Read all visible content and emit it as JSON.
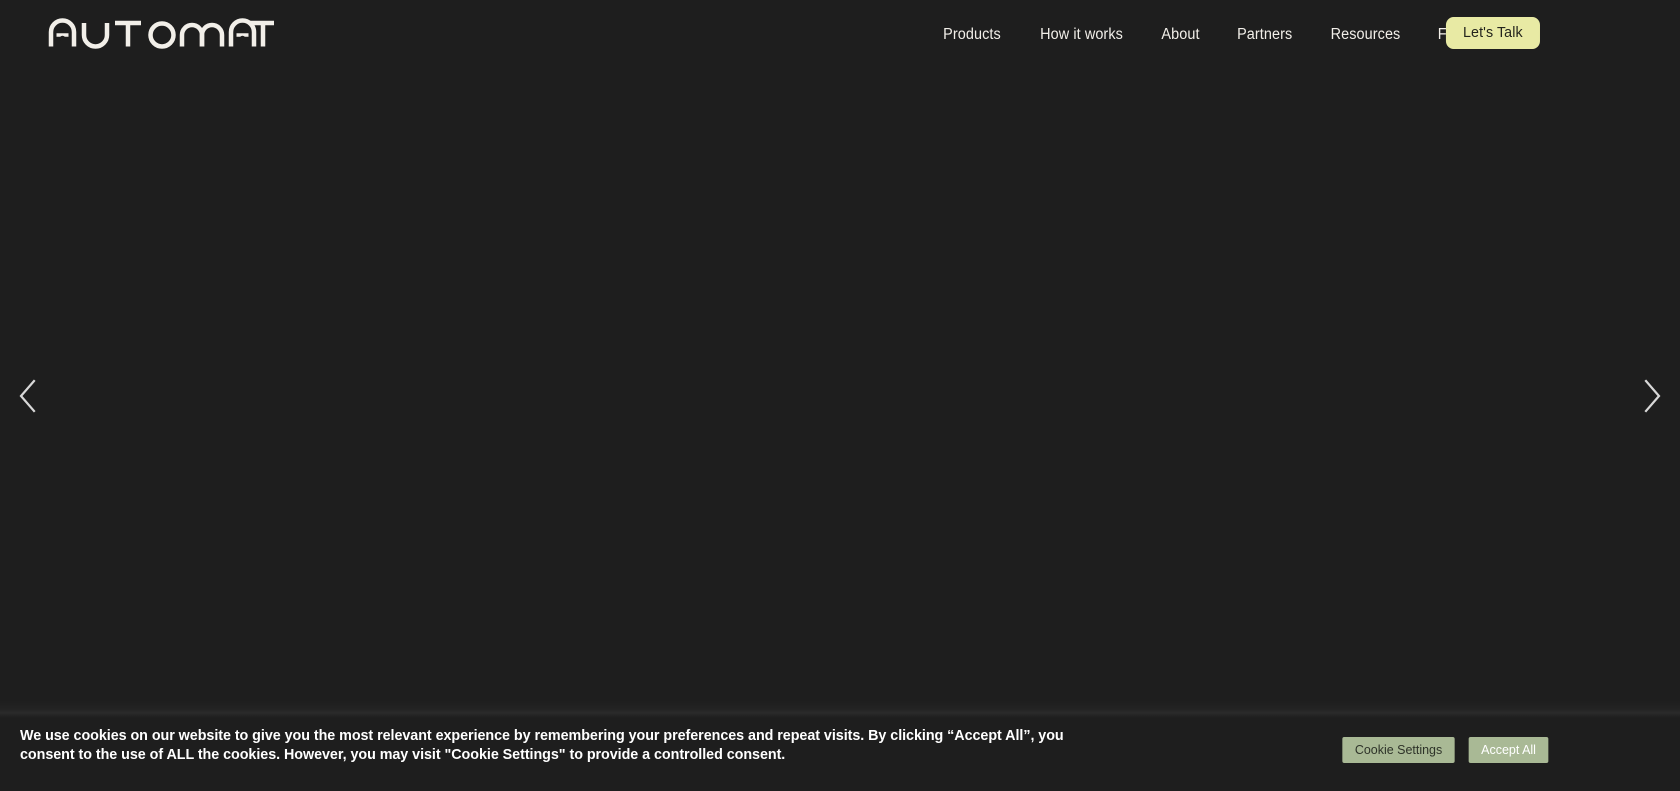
{
  "site": {
    "background_color": "#1e1e1e",
    "brand_name": "AUTOMAT",
    "accent_color": "#e8eaa4",
    "cookie_button_color": "#a9b995",
    "text_color": "#f2efe9"
  },
  "header": {
    "logo_label": "AUTOMAT",
    "logo_icon": "automat-wordmark-logo",
    "nav_items": [
      {
        "label": "Products"
      },
      {
        "label": "How it works"
      },
      {
        "label": "About"
      },
      {
        "label": "Partners"
      },
      {
        "label": "Resources"
      },
      {
        "label": "FR"
      }
    ],
    "cta_label": "Let's Talk"
  },
  "hero": {
    "prev_icon": "chevron-left-icon",
    "next_icon": "chevron-right-icon",
    "prev_label": "Previous slide",
    "next_label": "Next slide",
    "slide_background": "#1e1e1e"
  },
  "cookie_banner": {
    "message_line_1": "We use cookies on our website to give you the most relevant experience by remembering your preferences and repeat visits. By clicking “Accept All”, you consent to the use of",
    "message_line_2": "ALL the cookies. However, you may visit \"Cookie Settings\" to provide a controlled consent.",
    "settings_label": "Cookie Settings",
    "accept_label": "Accept All"
  }
}
